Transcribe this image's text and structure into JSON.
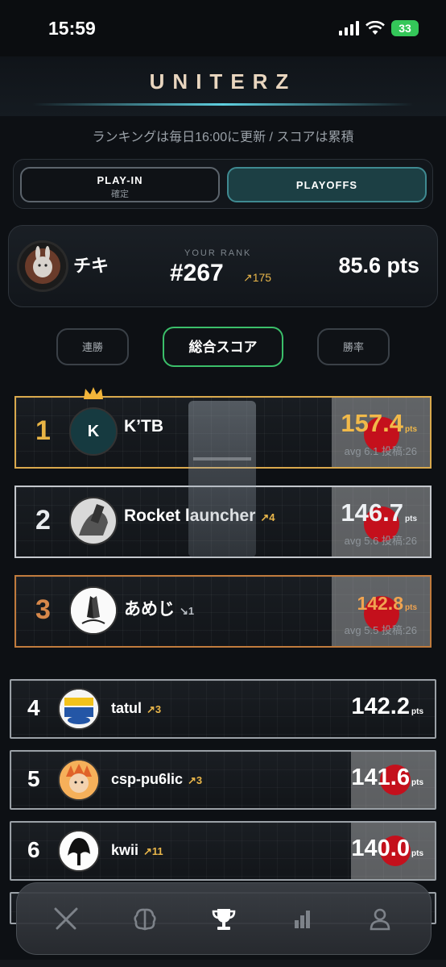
{
  "status": {
    "time": "15:59",
    "battery": "33"
  },
  "app": {
    "brand": "UNITERZ"
  },
  "notice": "ランキングは毎日16:00に更新 / スコアは累積",
  "segments": [
    {
      "label": "PLAY-IN",
      "sub": "確定",
      "active": false
    },
    {
      "label": "PLAYOFFS",
      "active": true
    }
  ],
  "me": {
    "name": "チキ",
    "rank_label": "YOUR RANK",
    "rank": "#267",
    "trend": "↗175",
    "points": "85.6 pts"
  },
  "sort_tabs": [
    {
      "label": "連勝",
      "active": false
    },
    {
      "label": "総合スコア",
      "active": true
    },
    {
      "label": "勝率",
      "active": false
    }
  ],
  "top3": [
    {
      "rank": "1",
      "name": "K’TB",
      "avatar_letter": "K",
      "trend": "",
      "score": "157.4",
      "unit": "pts",
      "avg": "avg 6.1 投稿:26"
    },
    {
      "rank": "2",
      "name": "Rocket launcher",
      "trend": "↗4",
      "score": "146.7",
      "unit": "pts",
      "avg": "avg 5.6 投稿:26"
    },
    {
      "rank": "3",
      "name": "あめじ",
      "trend": "↘1",
      "score": "142.8",
      "unit": "pts",
      "avg": "avg 5.5 投稿:26"
    }
  ],
  "list": [
    {
      "rank": "4",
      "name": "tatul",
      "trend": "↗3",
      "score": "142.2",
      "unit": "pts"
    },
    {
      "rank": "5",
      "name": "csp-pu6lic",
      "trend": "↗3",
      "score": "141.6",
      "unit": "pts"
    },
    {
      "rank": "6",
      "name": "kwii",
      "trend": "↗11",
      "score": "140.0",
      "unit": "pts"
    }
  ],
  "nav": [
    "battle-icon",
    "brain-icon",
    "trophy-icon",
    "chart-icon",
    "profile-icon"
  ],
  "colors": {
    "accent": "#3bbf6a",
    "gold": "#e8b445",
    "teal": "#1c3f44"
  }
}
